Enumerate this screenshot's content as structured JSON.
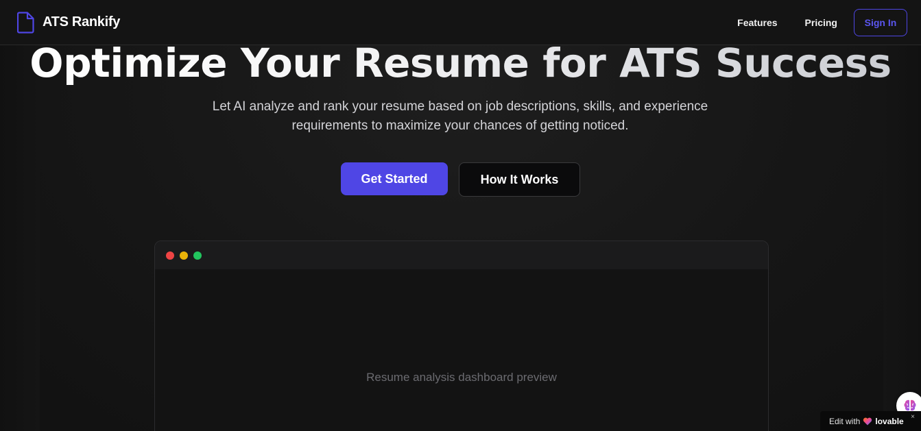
{
  "nav": {
    "brand": "ATS Rankify",
    "links": [
      {
        "label": "Features"
      },
      {
        "label": "Pricing"
      }
    ],
    "sign_in": "Sign In"
  },
  "hero": {
    "title": "Optimize Your Resume for ATS Success",
    "subtitle_line1": "Let AI analyze and rank your resume based on job descriptions, skills, and experience",
    "subtitle_line2": "requirements to maximize your chances of getting noticed.",
    "primary_cta": "Get Started",
    "secondary_cta": "How It Works"
  },
  "preview": {
    "placeholder": "Resume analysis dashboard preview",
    "window_dots": [
      "red",
      "yellow",
      "green"
    ]
  },
  "badge": {
    "prefix": "Edit with",
    "brand": "lovable",
    "close": "×"
  },
  "colors": {
    "accent": "#4f46e5",
    "background": "#141414",
    "dot_red": "#ef4444",
    "dot_yellow": "#eab308",
    "dot_green": "#22c55e"
  },
  "icons": {
    "brand": "file-icon",
    "floating": "brain-icon",
    "badge": "heart-icon"
  }
}
